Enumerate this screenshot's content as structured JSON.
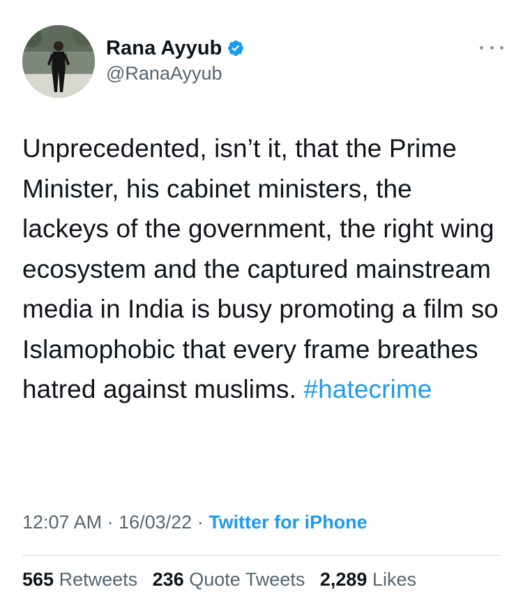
{
  "user": {
    "display_name": "Rana Ayyub",
    "handle": "@RanaAyyub",
    "verified_icon": "verified-badge-icon",
    "accent_color": "#1d9bf0"
  },
  "tweet": {
    "text": "Unprecedented, isn’t it, that the Prime Minister, his cabinet ministers, the lackeys of the government, the right wing ecosystem and the captured mainstream media in India is busy promoting a film so Islamophobic that every frame breathes hatred against muslims. ",
    "hashtag": "#hatecrime"
  },
  "meta": {
    "time": "12:07 AM",
    "separator1": " · ",
    "date": "16/03/22",
    "separator2": " · ",
    "source": "Twitter for iPhone"
  },
  "stats": {
    "retweets_count": "565",
    "retweets_label": "Retweets",
    "quotes_count": "236",
    "quotes_label": "Quote Tweets",
    "likes_count": "2,289",
    "likes_label": "Likes"
  }
}
